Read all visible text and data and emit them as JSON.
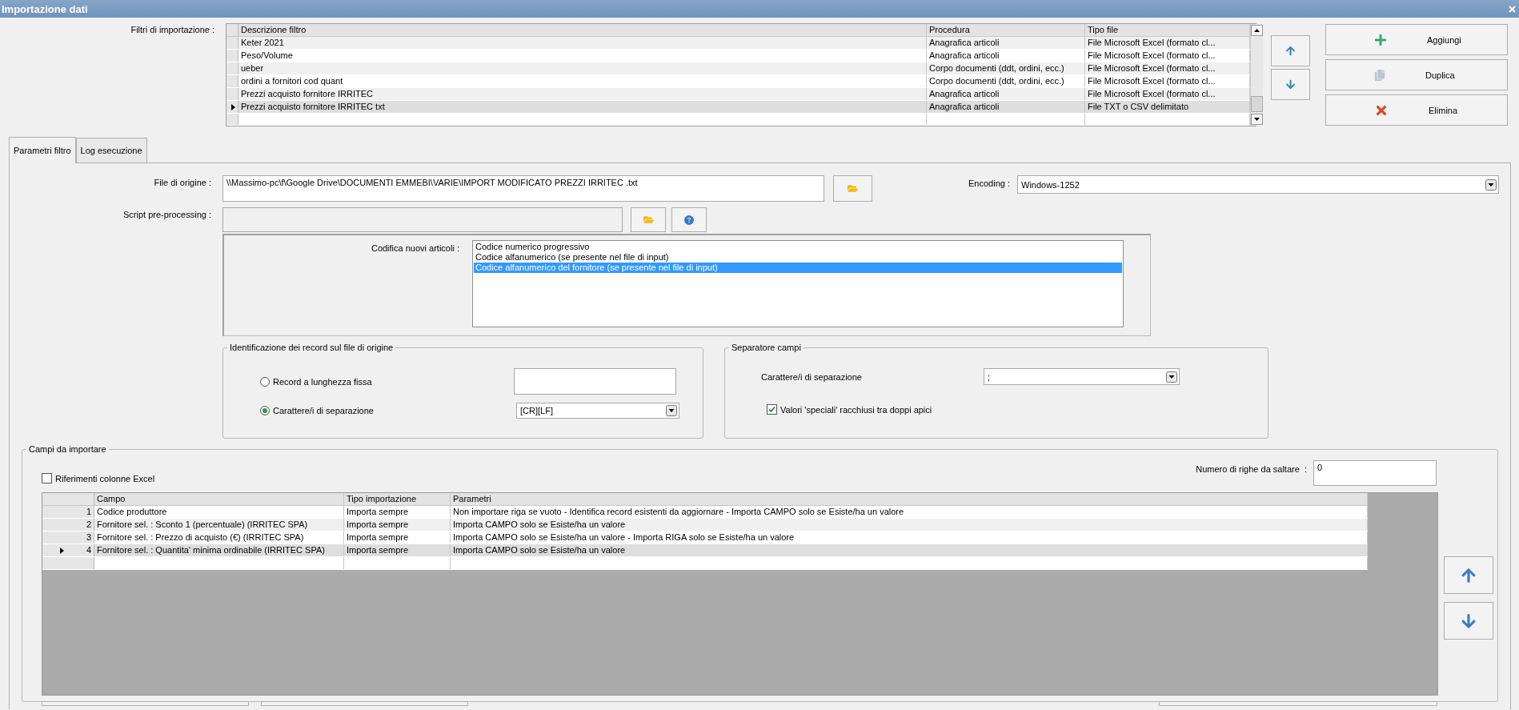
{
  "window": {
    "title": "Importazione dati"
  },
  "filters": {
    "label": "Filtri di importazione :",
    "columns": [
      "Descrizione filtro",
      "Procedura",
      "Tipo file"
    ],
    "rows": [
      {
        "cells": [
          "Keter 2021",
          "Anagrafica articoli",
          "File Microsoft Excel (formato cl..."
        ],
        "selected": false
      },
      {
        "cells": [
          "Peso/Volume",
          "Anagrafica articoli",
          "File Microsoft Excel (formato cl..."
        ],
        "selected": false
      },
      {
        "cells": [
          "ueber",
          "Corpo documenti (ddt, ordini, ecc.)",
          "File Microsoft Excel (formato cl..."
        ],
        "selected": false
      },
      {
        "cells": [
          "ordini a fornitori cod quant",
          "Corpo documenti (ddt, ordini, ecc.)",
          "File Microsoft Excel (formato cl..."
        ],
        "selected": false
      },
      {
        "cells": [
          "Prezzi acquisto fornitore IRRITEC",
          "Anagrafica articoli",
          "File Microsoft Excel (formato cl..."
        ],
        "selected": false
      },
      {
        "cells": [
          "Prezzi acquisto fornitore IRRITEC txt",
          "Anagrafica articoli",
          "File TXT o CSV delimitato"
        ],
        "selected": true
      }
    ]
  },
  "filter_buttons": [
    {
      "label": "Aggiungi",
      "kind": "add"
    },
    {
      "label": "Duplica",
      "kind": "duplicate"
    },
    {
      "label": "Elimina",
      "kind": "delete"
    }
  ],
  "tabs": [
    {
      "label": "Parametri filtro",
      "selected": true
    },
    {
      "label": "Log esecuzione",
      "selected": false
    }
  ],
  "source_file": {
    "label": "File di origine :",
    "value": "\\\\Massimo-pc\\f\\Google Drive\\DOCUMENTI EMMEBI\\VARIE\\IMPORT MODIFICATO PREZZI IRRITEC .txt"
  },
  "encoding": {
    "label": "Encoding :",
    "value": "Windows-1252"
  },
  "script": {
    "label": "Script pre-processing :",
    "disabled": true
  },
  "article_coding": {
    "label": "Codifica nuovi articoli :",
    "options": [
      {
        "label": "Codice numerico progressivo",
        "selected": false
      },
      {
        "label": "Codice alfanumerico (se presente nel file di input)",
        "selected": false
      },
      {
        "label": "Codice alfanumerico del fornitore (se presente nel file di input)",
        "selected": true
      }
    ]
  },
  "record_identification": {
    "title": "Identificazione dei record sul file di origine",
    "options": [
      {
        "label": "Record a lunghezza fissa",
        "selected": false,
        "kind": "text"
      },
      {
        "label": "Carattere/i di separazione",
        "selected": true,
        "kind": "combo",
        "value": "[CR][LF]"
      }
    ]
  },
  "field_separator": {
    "title": "Separatore campi",
    "label": "Carattere/i di separazione",
    "value": ";",
    "quoted": {
      "label": "Valori 'speciali' racchiusi tra doppi apici",
      "checked": true
    }
  },
  "fields": {
    "title": "Campi da importare",
    "excel_refs": {
      "label": "Riferimenti colonne Excel",
      "checked": false
    },
    "skip_rows": {
      "label": "Numero di righe da saltare  :",
      "value": "0"
    },
    "columns": [
      "Campo",
      "Tipo importazione",
      "Parametri"
    ],
    "rows": [
      {
        "number": "1",
        "cells": [
          "Codice produttore",
          "Importa sempre",
          "Non importare riga se vuoto - Identifica record esistenti da aggiornare - Importa CAMPO solo se Esiste/ha un valore"
        ],
        "selected": false
      },
      {
        "number": "2",
        "cells": [
          "Fornitore sel. : Sconto 1 (percentuale) (IRRITEC SPA)",
          "Importa sempre",
          "Importa CAMPO solo se Esiste/ha un valore"
        ],
        "selected": false
      },
      {
        "number": "3",
        "cells": [
          "Fornitore sel. : Prezzo di acquisto (€) (IRRITEC SPA)",
          "Importa sempre",
          "Importa CAMPO solo se Esiste/ha un valore  - Importa RIGA solo se Esiste/ha un valore"
        ],
        "selected": false
      },
      {
        "number": "4",
        "cells": [
          "Fornitore sel. : Quantita' minima ordinabile (IRRITEC SPA)",
          "Importa sempre",
          "Importa CAMPO solo se Esiste/ha un valore"
        ],
        "selected": true
      }
    ]
  }
}
